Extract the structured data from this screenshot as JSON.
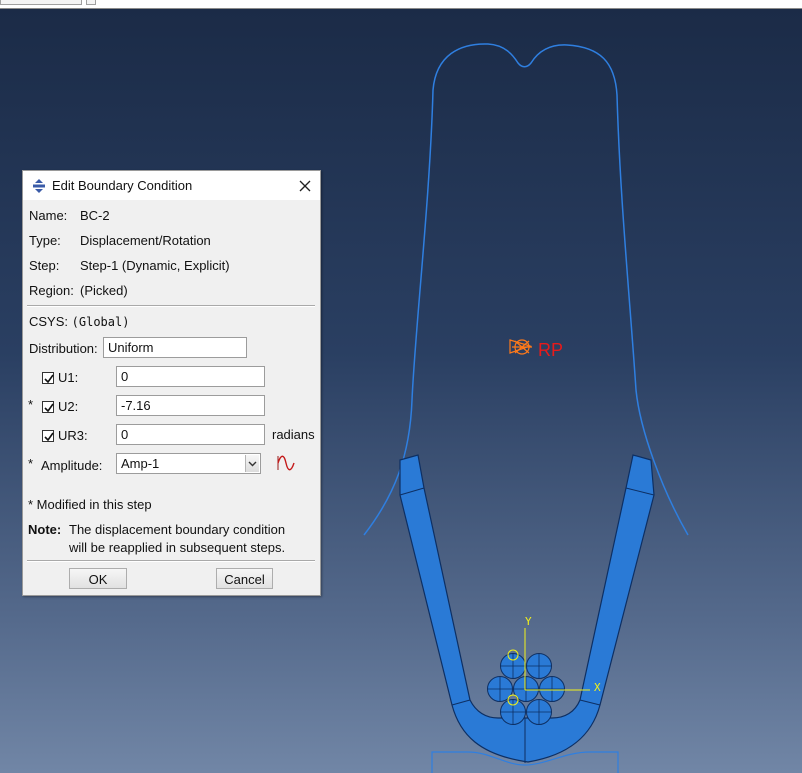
{
  "scene": {
    "rp_label": "RP",
    "axis_y": "Y",
    "axis_x": "X"
  },
  "dialog": {
    "title": "Edit Boundary Condition",
    "name_label": "Name:",
    "name_value": "BC-2",
    "type_label": "Type:",
    "type_value": "Displacement/Rotation",
    "step_label": "Step:",
    "step_value": "Step-1 (Dynamic, Explicit)",
    "region_label": "Region:",
    "region_value": "(Picked)",
    "csys_label": "CSYS:",
    "csys_value": "(Global)",
    "distribution_label": "Distribution:",
    "distribution_value": "Uniform",
    "u1_label": "U1:",
    "u1_value": "0",
    "u2_label": "U2:",
    "u2_value": "-7.16",
    "ur3_label": "UR3:",
    "ur3_value": "0",
    "ur3_unit": "radians",
    "modified_marker": "*",
    "amplitude_label": "Amplitude:",
    "amplitude_value": "Amp-1",
    "modified_note": "* Modified in this step",
    "note_label": "Note:",
    "note_line1": "The displacement boundary condition",
    "note_line2": "will be reapplied in subsequent steps.",
    "ok_label": "OK",
    "cancel_label": "Cancel"
  },
  "colors": {
    "viewport_top": "#1b2b47",
    "viewport_bottom": "#7186a6",
    "part_outline": "#2f7fe0",
    "part_fill": "#2a7ad6",
    "rp_color": "#e81a1a",
    "axis_color": "#f2f21a"
  }
}
